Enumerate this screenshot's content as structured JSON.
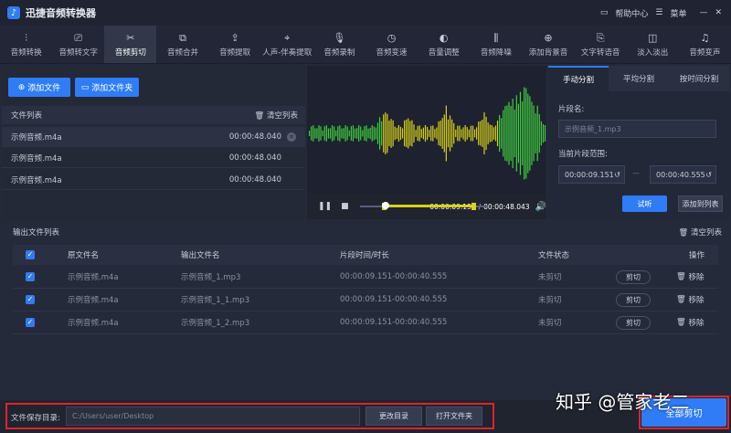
{
  "app": {
    "title": "迅捷音频转换器",
    "logo_char": "♪"
  },
  "window": {
    "help": "帮助中心",
    "menu": "菜单",
    "minimize": "—",
    "close": "✕"
  },
  "toolbar": [
    {
      "label": "音频转换",
      "icon": "waveform-icon"
    },
    {
      "label": "音频转文字",
      "icon": "text-icon"
    },
    {
      "label": "音频剪切",
      "icon": "scissors-icon",
      "active": true
    },
    {
      "label": "音频合并",
      "icon": "merge-icon"
    },
    {
      "label": "音频提取",
      "icon": "extract-icon"
    },
    {
      "label": "人声-伴奏提取",
      "icon": "vocal-icon"
    },
    {
      "label": "音频录制",
      "icon": "mic-icon"
    },
    {
      "label": "音频变速",
      "icon": "speed-icon"
    },
    {
      "label": "音量调整",
      "icon": "volume-icon"
    },
    {
      "label": "音频降噪",
      "icon": "denoise-icon"
    },
    {
      "label": "添加背景音",
      "icon": "bgm-icon"
    },
    {
      "label": "文字转语音",
      "icon": "tts-icon"
    },
    {
      "label": "淡入淡出",
      "icon": "fade-icon"
    },
    {
      "label": "音频变声",
      "icon": "voice-change-icon"
    }
  ],
  "left": {
    "add_file": "添加文件",
    "add_folder": "添加文件夹",
    "list_title": "文件列表",
    "clear_list": "清空列表",
    "files": [
      {
        "name": "示例音频.m4a",
        "duration": "00:00:48.040"
      },
      {
        "name": "示例音频.m4a",
        "duration": "00:00:48.040"
      },
      {
        "name": "示例音频.m4a",
        "duration": "00:00:48.040"
      }
    ]
  },
  "player": {
    "current": "00:00:09.151",
    "sep": "/",
    "total": "00:00:48.043",
    "preview": "试听",
    "add_to_list": "添加到列表"
  },
  "split": {
    "tabs": [
      "手动分割",
      "平均分割",
      "按时间分割"
    ],
    "segment_label": "片段名:",
    "segment_value": "示例音频_1.mp3",
    "range_label": "当前片段范围:",
    "start": "00:00:09.151",
    "end": "00:00:40.555",
    "dash": "—"
  },
  "output": {
    "title": "输出文件列表",
    "clear": "清空列表",
    "headers": {
      "check": "✓",
      "src": "原文件名",
      "out": "输出文件名",
      "range": "片段时间/时长",
      "status": "文件状态",
      "action": "操作"
    },
    "rows": [
      {
        "check": "✓",
        "src": "示例音频.m4a",
        "out": "示例音频_1.mp3",
        "range": "00:00:09.151-00:00:40.555",
        "status": "未剪切",
        "cut": "剪切",
        "remove": "移除"
      },
      {
        "check": "✓",
        "src": "示例音频.m4a",
        "out": "示例音频_1_1.mp3",
        "range": "00:00:09.151-00:00:40.555",
        "status": "未剪切",
        "cut": "剪切",
        "remove": "移除"
      },
      {
        "check": "✓",
        "src": "示例音频.m4a",
        "out": "示例音频_1_2.mp3",
        "range": "00:00:09.151-00:00:40.555",
        "status": "未剪切",
        "cut": "剪切",
        "remove": "移除"
      }
    ]
  },
  "bottom": {
    "dir_label": "文件保存目录:",
    "dir_value": "C:/Users/user/Desktop",
    "change_dir": "更改目录",
    "open_folder": "打开文件夹",
    "cut_all": "全部剪切"
  },
  "watermark": "知乎 @管家老二",
  "colors": {
    "accent": "#2f7cf6",
    "wave_green": "#3ecf3e",
    "wave_yellow": "#d8d21a",
    "highlight_red": "#e0222c"
  }
}
